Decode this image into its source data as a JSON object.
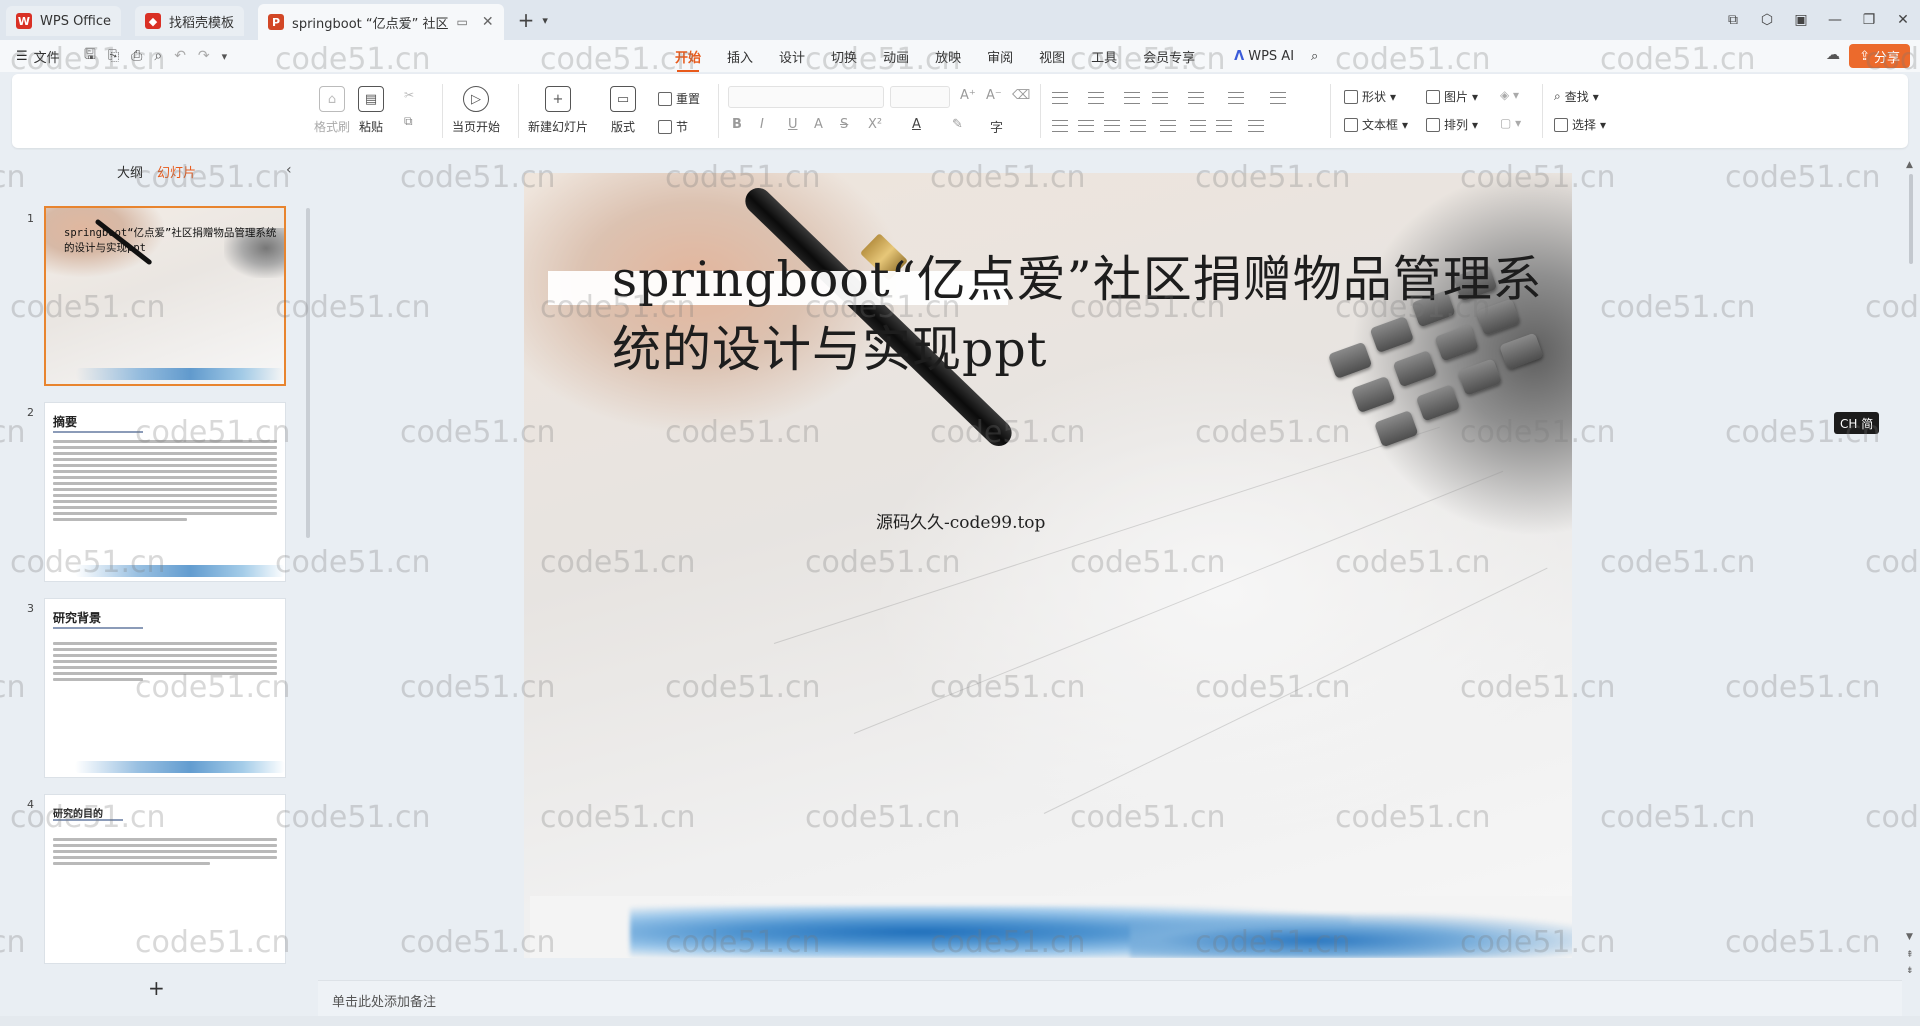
{
  "tabs": [
    {
      "label": "WPS Office",
      "icon": "wps-logo-icon"
    },
    {
      "label": "找稻壳模板",
      "icon": "docer-icon"
    },
    {
      "label": "springboot “亿点爱” 社区",
      "icon": "presentation-file-icon"
    }
  ],
  "menu": {
    "file_label": "文件",
    "items": [
      "开始",
      "插入",
      "设计",
      "切换",
      "动画",
      "放映",
      "审阅",
      "视图",
      "工具",
      "会员专享"
    ],
    "active": "开始",
    "wps_ai_label": "WPS AI",
    "share_label": "分享"
  },
  "ribbon": {
    "format_painter": "格式刷",
    "paste": "粘贴",
    "play_from_current": "当页开始",
    "new_slide": "新建幻灯片",
    "layout": "版式",
    "reset": "重置",
    "section": "节",
    "shape": "形状",
    "picture": "图片",
    "textbox": "文本框",
    "arrange": "排列",
    "find": "查找",
    "select": "选择"
  },
  "panel": {
    "tab_outline": "大纲",
    "tab_slides": "幻灯片",
    "active_tab": "幻灯片"
  },
  "thumbnails": [
    {
      "num": "1",
      "title": "springboot“亿点爱”社区捐赠物品管理系统的设计与实现ppt"
    },
    {
      "num": "2",
      "heading": "摘要"
    },
    {
      "num": "3",
      "heading": "研究背景"
    },
    {
      "num": "4",
      "heading": "研究的目的"
    }
  ],
  "slide": {
    "title": "springboot“亿点爱”社区捐赠物品管理系统的设计与实现ppt",
    "subtitle": "源码久久-code99.top"
  },
  "ime": {
    "label": "CH 简"
  },
  "notes": {
    "placeholder": "单击此处添加备注"
  },
  "watermark": "code51.cn",
  "colors": {
    "accent": "#e85a1b",
    "share": "#ec6a2c",
    "selected_thumb": "#e8842e"
  }
}
